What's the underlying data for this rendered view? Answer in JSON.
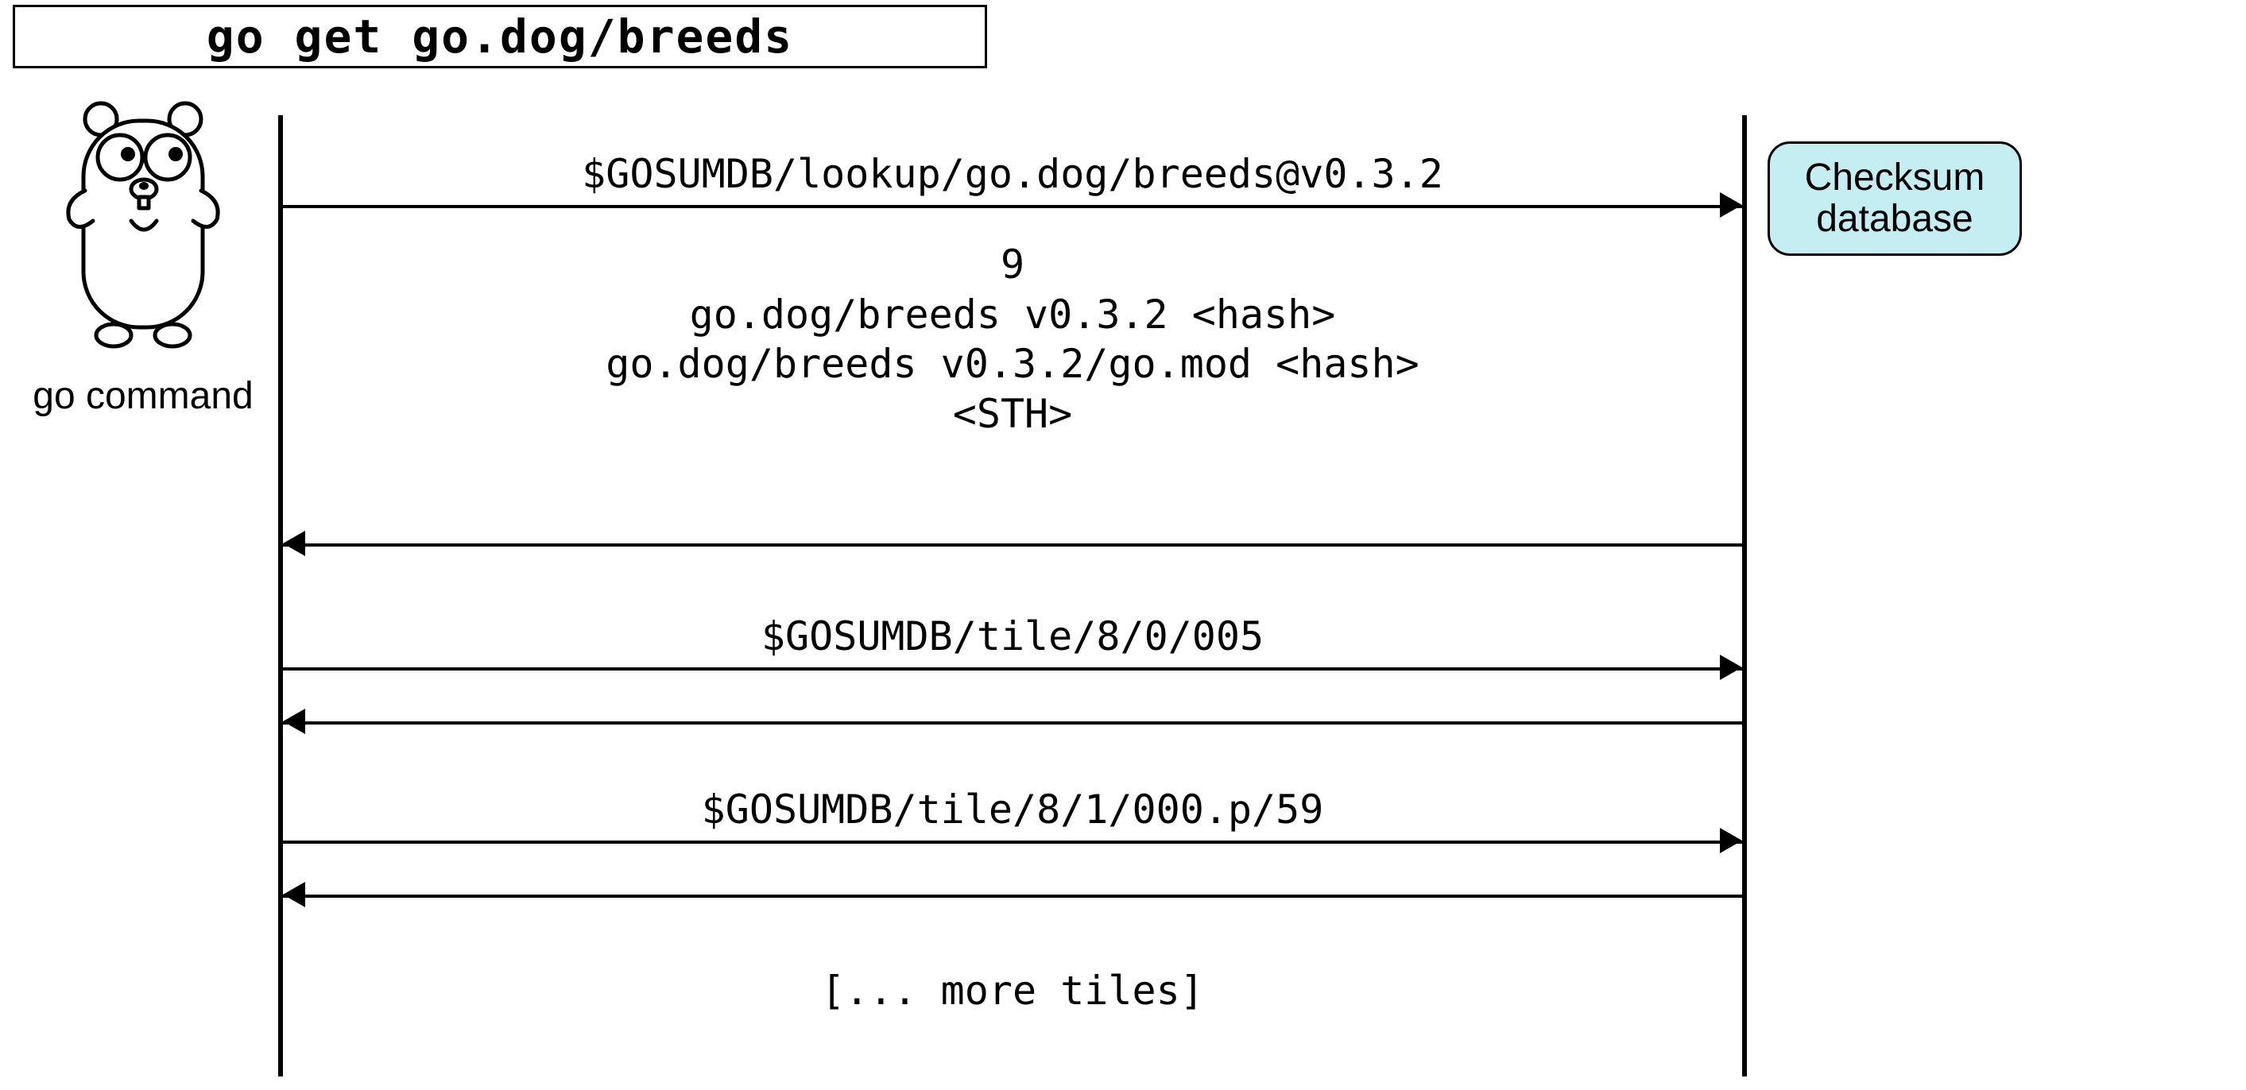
{
  "title": "go get go.dog/breeds",
  "actors": {
    "left_label": "go\ncommand",
    "right_label": "Checksum\ndatabase"
  },
  "messages": {
    "m1_request": "$GOSUMDB/lookup/go.dog/breeds@v0.3.2",
    "m1_response": "9\ngo.dog/breeds v0.3.2 <hash>\ngo.dog/breeds v0.3.2/go.mod <hash>\n<STH>",
    "m2_request": "$GOSUMDB/tile/8/0/005",
    "m3_request": "$GOSUMDB/tile/8/1/000.p/59",
    "more": "[... more tiles]"
  }
}
